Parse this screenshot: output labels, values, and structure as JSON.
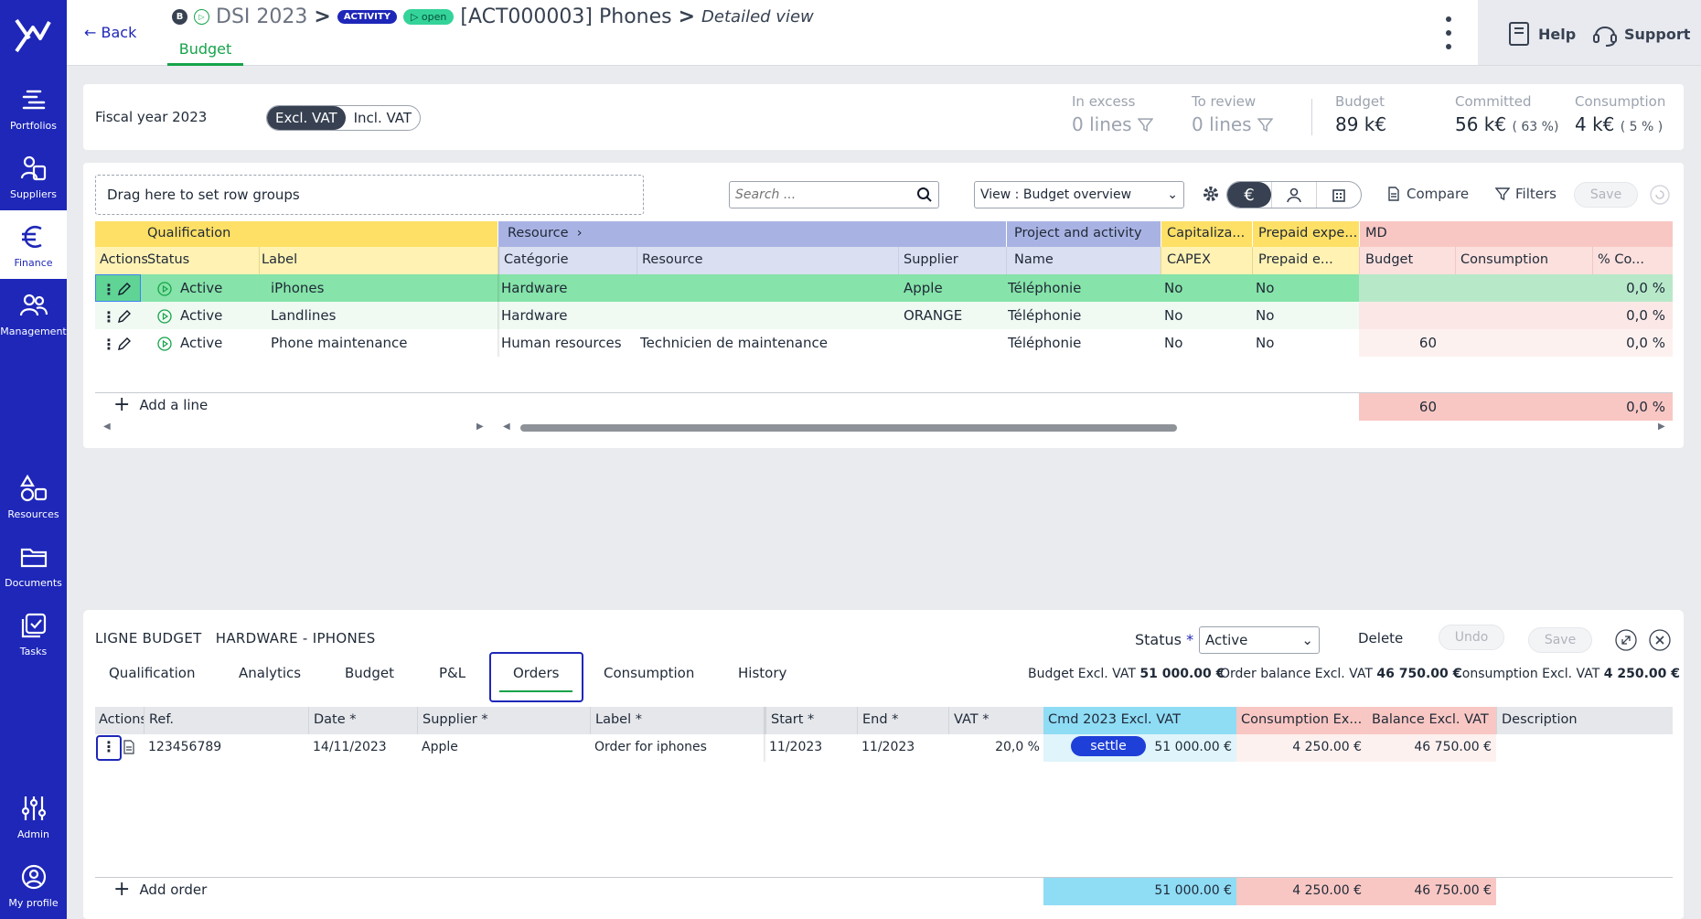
{
  "nav": {
    "portfolios": "Portfolios",
    "suppliers": "Suppliers",
    "finance": "Finance",
    "management": "Management",
    "resources": "Resources",
    "documents": "Documents",
    "tasks": "Tasks",
    "admin": "Admin",
    "profile": "My profile"
  },
  "header": {
    "back": "Back",
    "badge_b": "B",
    "crumb_dsi": "DSI 2023",
    "sep": ">",
    "badge_activity": "ACTIVITY",
    "badge_open": "▷ open",
    "title": "[ACT000003] Phones",
    "view": "Detailed view",
    "tab": "Budget",
    "help": "Help",
    "support": "Support"
  },
  "fiscal": {
    "label": "Fiscal year 2023",
    "excl": "Excl. VAT",
    "incl": "Incl. VAT",
    "in_excess_label": "In excess",
    "in_excess_value": "0  lines",
    "to_review_label": "To review",
    "to_review_value": "0  lines",
    "budget_label": "Budget",
    "budget_value": "89 k€",
    "committed_label": "Committed",
    "committed_value": "56 k€",
    "committed_pct": "( 63 %)",
    "consumption_label": "Consumption",
    "consumption_value": "4 k€",
    "consumption_pct": "( 5 % )"
  },
  "toolbar": {
    "dropzone": "Drag here to set row groups",
    "search_placeholder": "Search ...",
    "view": "View : Budget overview",
    "currency_icon": "€",
    "compare": "Compare",
    "filters": "Filters",
    "save": "Save"
  },
  "grid": {
    "groups": {
      "qualification": "Qualification",
      "resource": "Resource",
      "project": "Project and activity",
      "capitalization": "Capitaliza...",
      "prepaid": "Prepaid expe...",
      "md": "MD"
    },
    "columns": {
      "actions": "Actions",
      "status": "Status",
      "label": "Label",
      "categorie": "Catégorie",
      "resource": "Resource",
      "supplier": "Supplier",
      "name": "Name",
      "capex": "CAPEX",
      "prepaid": "Prepaid e...",
      "budget": "Budget",
      "consumption": "Consumption",
      "pct": "% Co..."
    },
    "rows": [
      {
        "status": "Active",
        "label": "iPhones",
        "categorie": "Hardware",
        "resource": "",
        "supplier": "Apple",
        "name": "Téléphonie",
        "capex": "No",
        "prepaid": "No",
        "budget": "",
        "consumption": "",
        "pct": "0,0 %"
      },
      {
        "status": "Active",
        "label": "Landlines",
        "categorie": "Hardware",
        "resource": "",
        "supplier": "ORANGE",
        "name": "Téléphonie",
        "capex": "No",
        "prepaid": "No",
        "budget": "",
        "consumption": "",
        "pct": "0,0 %"
      },
      {
        "status": "Active",
        "label": "Phone maintenance",
        "categorie": "Human resources",
        "resource": "Technicien de maintenance",
        "supplier": "",
        "name": "Téléphonie",
        "capex": "No",
        "prepaid": "No",
        "budget": "60",
        "consumption": "",
        "pct": "0,0 %"
      }
    ],
    "add_line": "Add a line",
    "total_budget": "60",
    "total_pct": "0,0 %"
  },
  "panel": {
    "title_prefix": "LIGNE BUDGET",
    "title": "HARDWARE - IPHONES",
    "status_label": "Status",
    "status_required": "*",
    "status_value": "Active",
    "delete": "Delete",
    "undo": "Undo",
    "save": "Save",
    "tabs": [
      "Qualification",
      "Analytics",
      "Budget",
      "P&L",
      "Orders",
      "Consumption",
      "History"
    ],
    "summary": {
      "budget_label": "Budget Excl. VAT",
      "budget_value": "51 000.00 €",
      "order_label": "Order balance Excl. VAT",
      "order_value": "46 750.00 €",
      "cons_label": "Consumption Excl. VAT",
      "cons_value": "4 250.00 €"
    },
    "columns": {
      "actions": "Actions",
      "ref": "Ref.",
      "date": "Date *",
      "supplier": "Supplier *",
      "label": "Label *",
      "start": "Start *",
      "end": "End *",
      "vat": "VAT *",
      "cmd": "Cmd 2023 Excl. VAT",
      "consumption": "Consumption Ex...",
      "balance": "Balance Excl. VAT",
      "description": "Description"
    },
    "order": {
      "ref": "123456789",
      "date": "14/11/2023",
      "supplier": "Apple",
      "label": "Order for iphones",
      "start": "11/2023",
      "end": "11/2023",
      "vat": "20,0 %",
      "settle": "settle",
      "cmd": "51 000.00 €",
      "consumption": "4 250.00 €",
      "balance": "46 750.00 €"
    },
    "add_order": "Add order",
    "totals": {
      "cmd": "51 000.00 €",
      "consumption": "4 250.00 €",
      "balance": "46 750.00 €"
    }
  },
  "colors": {
    "brand": "#1e27b8",
    "green": "#16a34a",
    "qualification": "#ffe066",
    "resource": "#a9b3e3",
    "md": "#f9c7c3",
    "cmd": "#8fdcf5"
  }
}
